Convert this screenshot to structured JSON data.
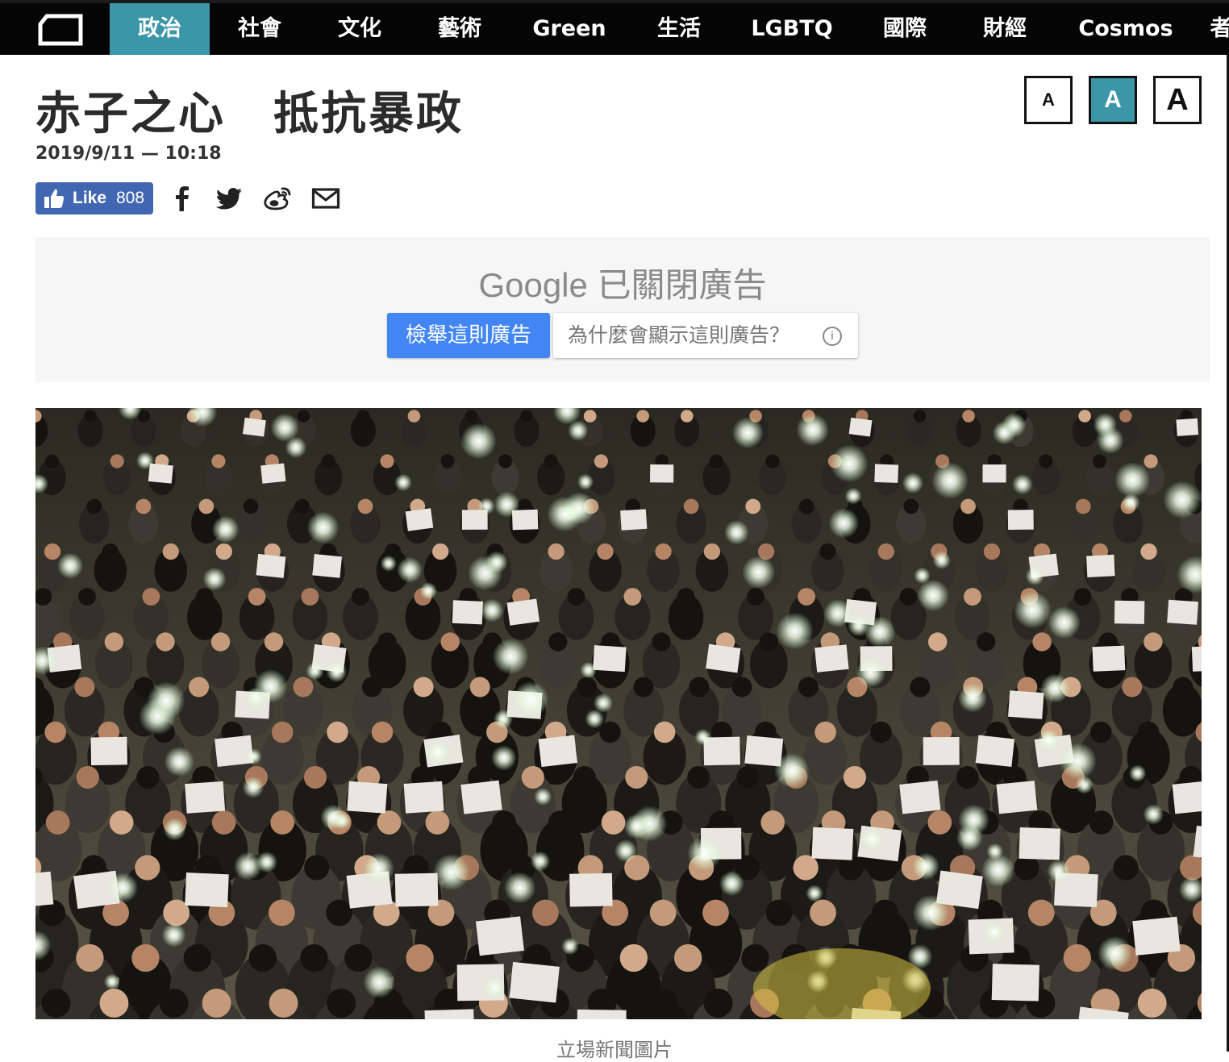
{
  "nav": {
    "items": [
      {
        "label": "政治",
        "active": true
      },
      {
        "label": "社會",
        "active": false
      },
      {
        "label": "文化",
        "active": false
      },
      {
        "label": "藝術",
        "active": false
      },
      {
        "label": "Green",
        "active": false
      },
      {
        "label": "生活",
        "active": false
      },
      {
        "label": "LGBTQ",
        "active": false
      },
      {
        "label": "國際",
        "active": false
      },
      {
        "label": "財經",
        "active": false
      },
      {
        "label": "Cosmos",
        "active": false
      },
      {
        "label": "者",
        "active": false
      }
    ]
  },
  "article": {
    "title": "赤子之心　抵抗暴政",
    "date": "2019/9/11 — 10:18"
  },
  "font_size": {
    "options": [
      "A",
      "A",
      "A"
    ],
    "selected_index": 1
  },
  "social": {
    "like_label": "Like",
    "like_count": "808",
    "icons": [
      "facebook-icon",
      "twitter-icon",
      "weibo-icon",
      "email-icon"
    ]
  },
  "ad": {
    "title": "Google 已關閉廣告",
    "report_label": "檢舉這則廣告",
    "why_label": "為什麼會顯示這則廣告？",
    "info_symbol": "i"
  },
  "photo": {
    "caption": "立場新聞圖片"
  },
  "colors": {
    "nav_bg": "#050505",
    "accent": "#3b96a7",
    "facebook": "#4267b2",
    "ad_button": "#4285f4"
  }
}
